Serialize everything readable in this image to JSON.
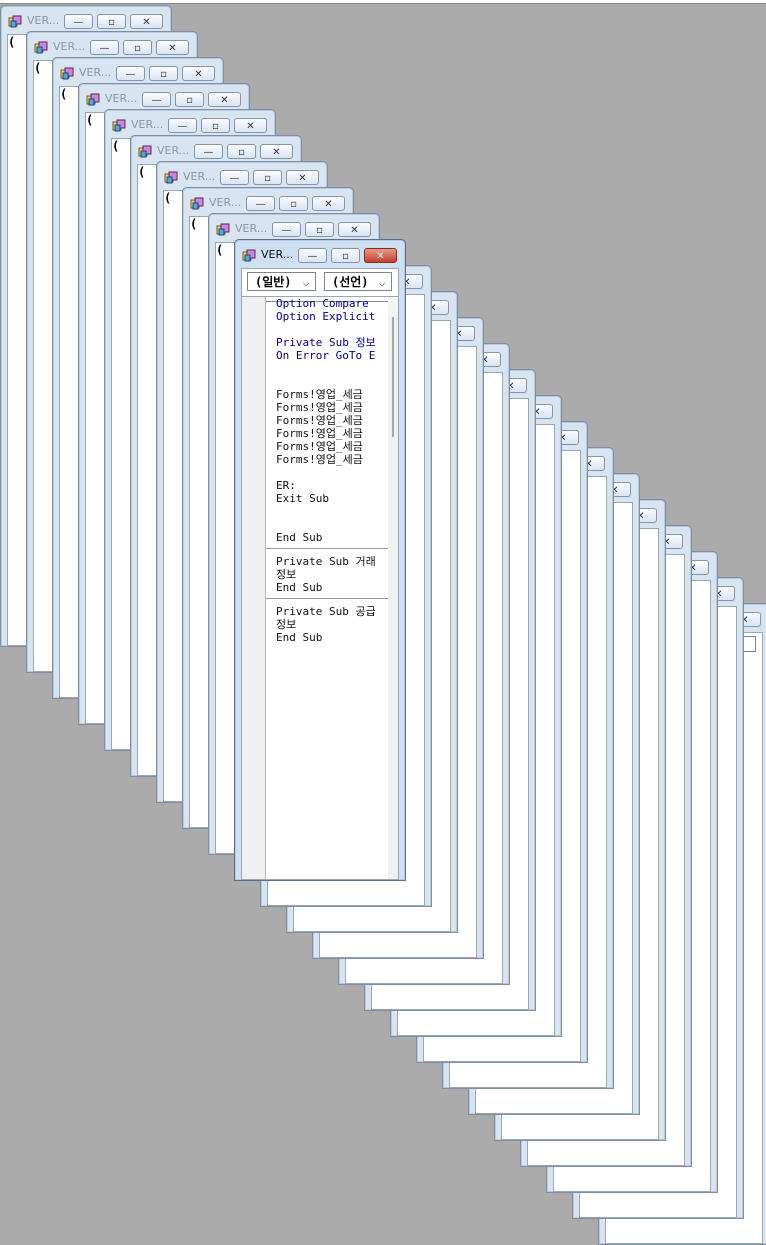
{
  "window": {
    "title": "VER...",
    "minimize_label": "—",
    "restore_label": "▫",
    "close_label": "✕"
  },
  "combos": {
    "object": "(일반)",
    "procedure": "(선언)",
    "arrow": "⌵"
  },
  "code_lines": [
    {
      "text": "Option Compare",
      "kind": "kw"
    },
    {
      "text": "Option Explicit",
      "kind": "kw"
    },
    {
      "text": "",
      "kind": "blank"
    },
    {
      "text": "Private Sub 정보",
      "kind": "kw"
    },
    {
      "text": "On Error GoTo E",
      "kind": "kw"
    },
    {
      "text": "",
      "kind": "blank"
    },
    {
      "text": "",
      "kind": "blank"
    },
    {
      "text": "Forms!영업_세금",
      "kind": "text"
    },
    {
      "text": "Forms!영업_세금",
      "kind": "text"
    },
    {
      "text": "Forms!영업_세금",
      "kind": "text"
    },
    {
      "text": "Forms!영업_세금",
      "kind": "text"
    },
    {
      "text": "Forms!영업_세금",
      "kind": "text"
    },
    {
      "text": "Forms!영업_세금",
      "kind": "text"
    },
    {
      "text": "",
      "kind": "blank"
    },
    {
      "text": "ER:",
      "kind": "text"
    },
    {
      "text": "Exit Sub",
      "kind": "text"
    },
    {
      "text": "",
      "kind": "blank"
    },
    {
      "text": "",
      "kind": "blank"
    },
    {
      "text": "End Sub",
      "kind": "text"
    },
    {
      "text": "",
      "kind": "sep"
    },
    {
      "text": "Private Sub 거래",
      "kind": "text"
    },
    {
      "text": "정보",
      "kind": "text"
    },
    {
      "text": "End Sub",
      "kind": "text"
    },
    {
      "text": "",
      "kind": "sep"
    },
    {
      "text": "Private Sub 공급",
      "kind": "text"
    },
    {
      "text": "정보",
      "kind": "text"
    },
    {
      "text": "End Sub",
      "kind": "text"
    }
  ],
  "colors": {
    "desktop": "#ababab",
    "frame": "#d9e4f1",
    "keyword": "#00007f",
    "close_active": "#c4402c"
  },
  "icons": {
    "app": "vba-project-icon",
    "minimize": "minimize-icon",
    "restore": "restore-icon",
    "close": "close-icon"
  }
}
